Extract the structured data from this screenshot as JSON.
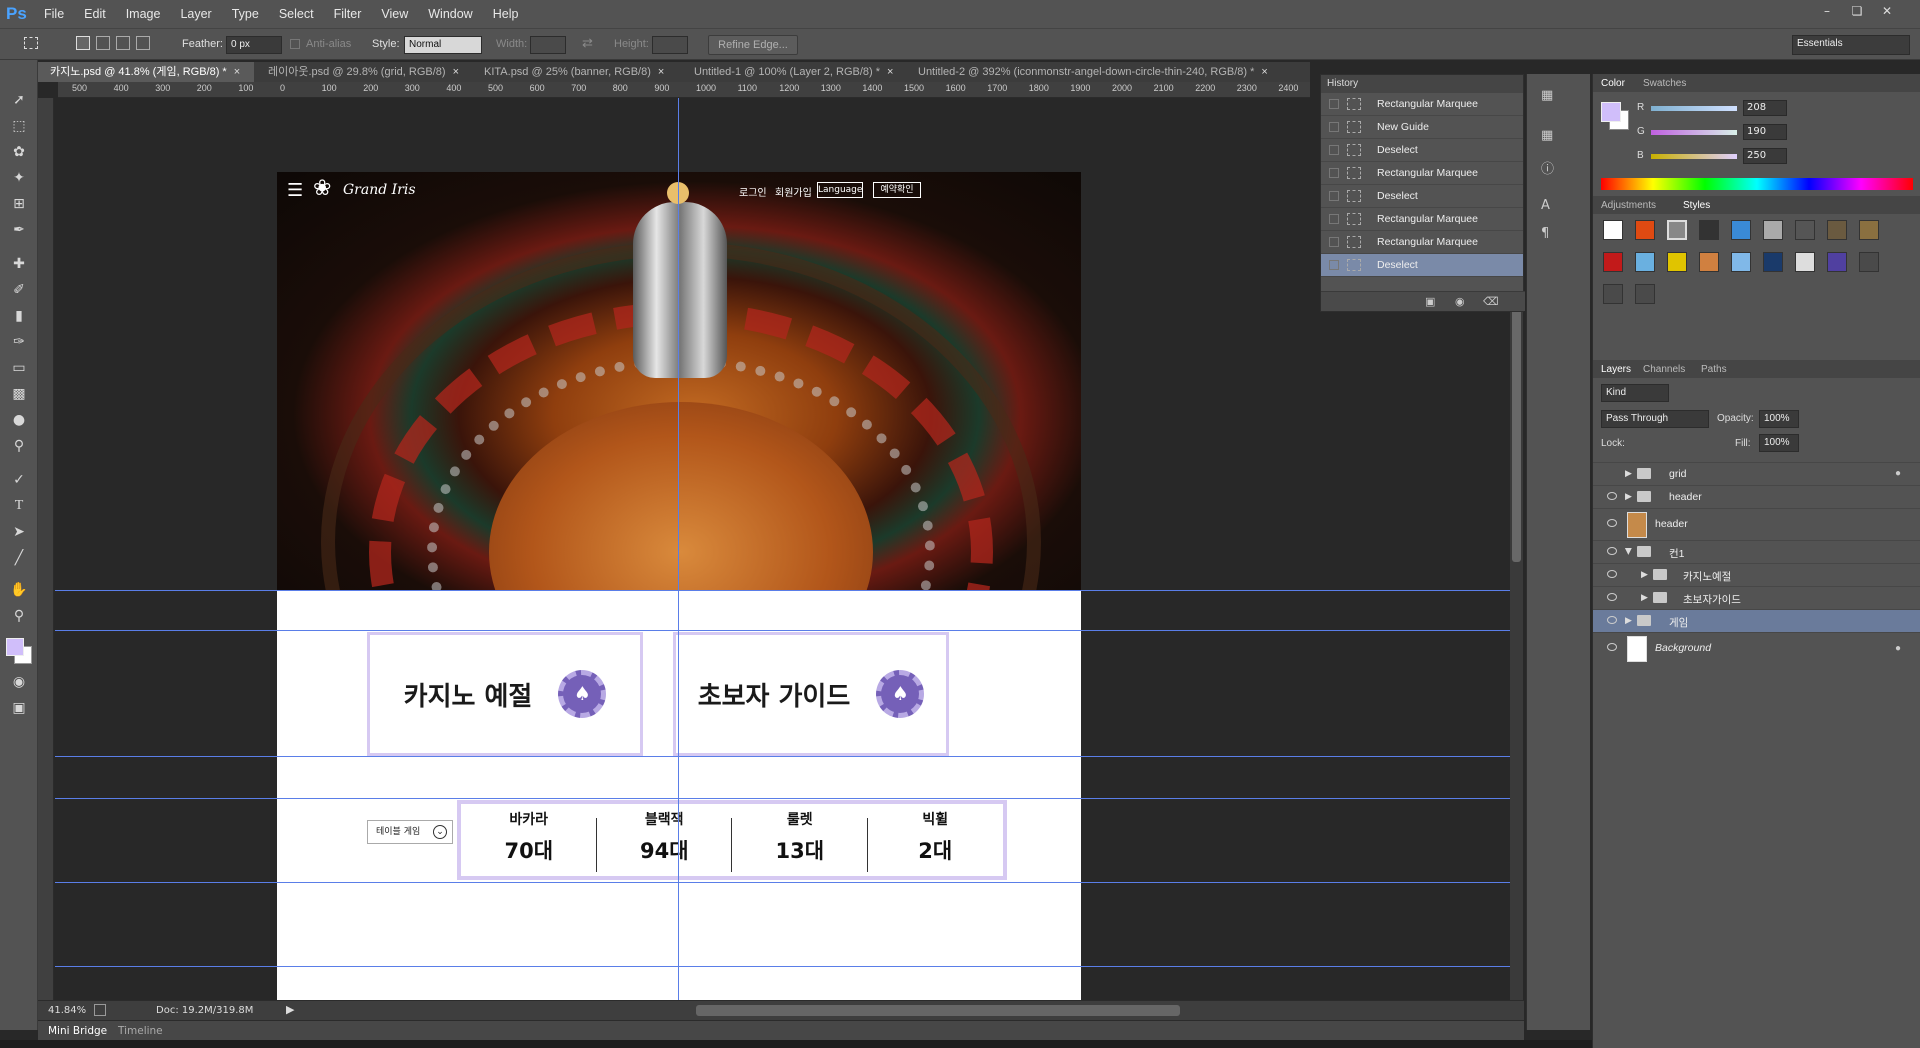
{
  "app": {
    "logo": "Ps"
  },
  "menu": [
    "File",
    "Edit",
    "Image",
    "Layer",
    "Type",
    "Select",
    "Filter",
    "View",
    "Window",
    "Help"
  ],
  "options": {
    "feather_label": "Feather:",
    "feather_value": "0 px",
    "antialias_label": "Anti-alias",
    "style_label": "Style:",
    "style_value": "Normal",
    "width_label": "Width:",
    "height_label": "Height:",
    "refine_edge": "Refine Edge...",
    "workspace": "Essentials"
  },
  "tabs": [
    "카지노.psd @ 41.8% (게임, RGB/8) *",
    "레이아웃.psd @ 29.8% (grid, RGB/8)",
    "KITA.psd @ 25% (banner, RGB/8)",
    "Untitled-1 @ 100% (Layer 2, RGB/8) *",
    "Untitled-2 @ 392% (iconmonstr-angel-down-circle-thin-240, RGB/8) *"
  ],
  "ruler_top": [
    "500",
    "400",
    "300",
    "200",
    "100",
    "0",
    "100",
    "200",
    "300",
    "400",
    "500",
    "600",
    "700",
    "800",
    "900",
    "1000",
    "1100",
    "1200",
    "1300",
    "1400",
    "1500",
    "1600",
    "1700",
    "1800",
    "1900",
    "2000",
    "2100",
    "2200",
    "2300",
    "2400"
  ],
  "document": {
    "brand": "Grand Iris",
    "nav_login": "로그인",
    "nav_join": "회원가입",
    "nav_language": "Language",
    "nav_reservation": "예약확인",
    "card1_title": "카지노 예절",
    "card2_title": "초보자 가이드",
    "selector_label": "테이블 게임",
    "stats": [
      {
        "name": "바카라",
        "value": "70대"
      },
      {
        "name": "블랙잭",
        "value": "94대"
      },
      {
        "name": "룰렛",
        "value": "13대"
      },
      {
        "name": "빅휠",
        "value": "2대"
      }
    ]
  },
  "status": {
    "zoom": "41.84%",
    "doc": "Doc: 19.2M/319.8M"
  },
  "bottom_tabs": {
    "mini_bridge": "Mini Bridge",
    "timeline": "Timeline"
  },
  "history": {
    "title": "History",
    "items": [
      "Rectangular Marquee",
      "New Guide",
      "Deselect",
      "Rectangular Marquee",
      "Deselect",
      "Rectangular Marquee",
      "Rectangular Marquee",
      "Deselect"
    ]
  },
  "color_panel": {
    "tab_color": "Color",
    "tab_swatches": "Swatches",
    "r_label": "R",
    "r": "208",
    "g_label": "G",
    "g": "190",
    "b_label": "B",
    "b": "250",
    "foreground": "#d0befa"
  },
  "adjust": {
    "tab_adjustments": "Adjustments",
    "tab_styles": "Styles"
  },
  "layers": {
    "tab_layers": "Layers",
    "tab_channels": "Channels",
    "tab_paths": "Paths",
    "kind": "Kind",
    "blend": "Pass Through",
    "opacity_label": "Opacity:",
    "opacity": "100%",
    "lock_label": "Lock:",
    "fill_label": "Fill:",
    "fill": "100%",
    "items": [
      "grid",
      "header",
      "header",
      "컨1",
      "카지노예절",
      "초보자가이드",
      "게임",
      "Background"
    ]
  }
}
